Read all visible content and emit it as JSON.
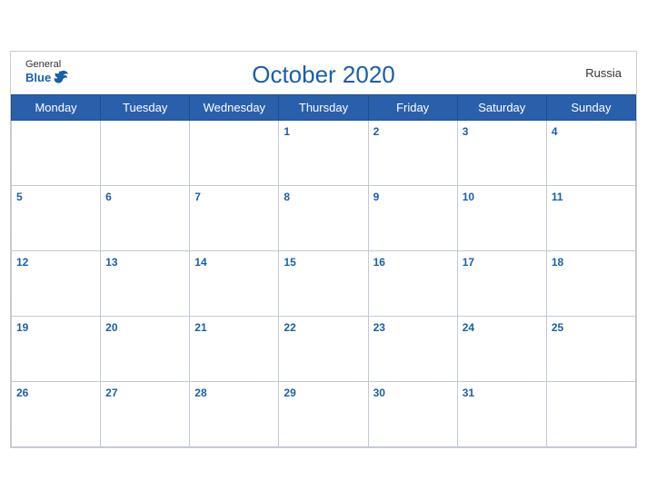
{
  "header": {
    "title": "October 2020",
    "logo_general": "General",
    "logo_blue": "Blue",
    "country": "Russia"
  },
  "days_of_week": [
    "Monday",
    "Tuesday",
    "Wednesday",
    "Thursday",
    "Friday",
    "Saturday",
    "Sunday"
  ],
  "weeks": [
    [
      null,
      null,
      null,
      1,
      2,
      3,
      4
    ],
    [
      5,
      6,
      7,
      8,
      9,
      10,
      11
    ],
    [
      12,
      13,
      14,
      15,
      16,
      17,
      18
    ],
    [
      19,
      20,
      21,
      22,
      23,
      24,
      25
    ],
    [
      26,
      27,
      28,
      29,
      30,
      31,
      null
    ]
  ]
}
